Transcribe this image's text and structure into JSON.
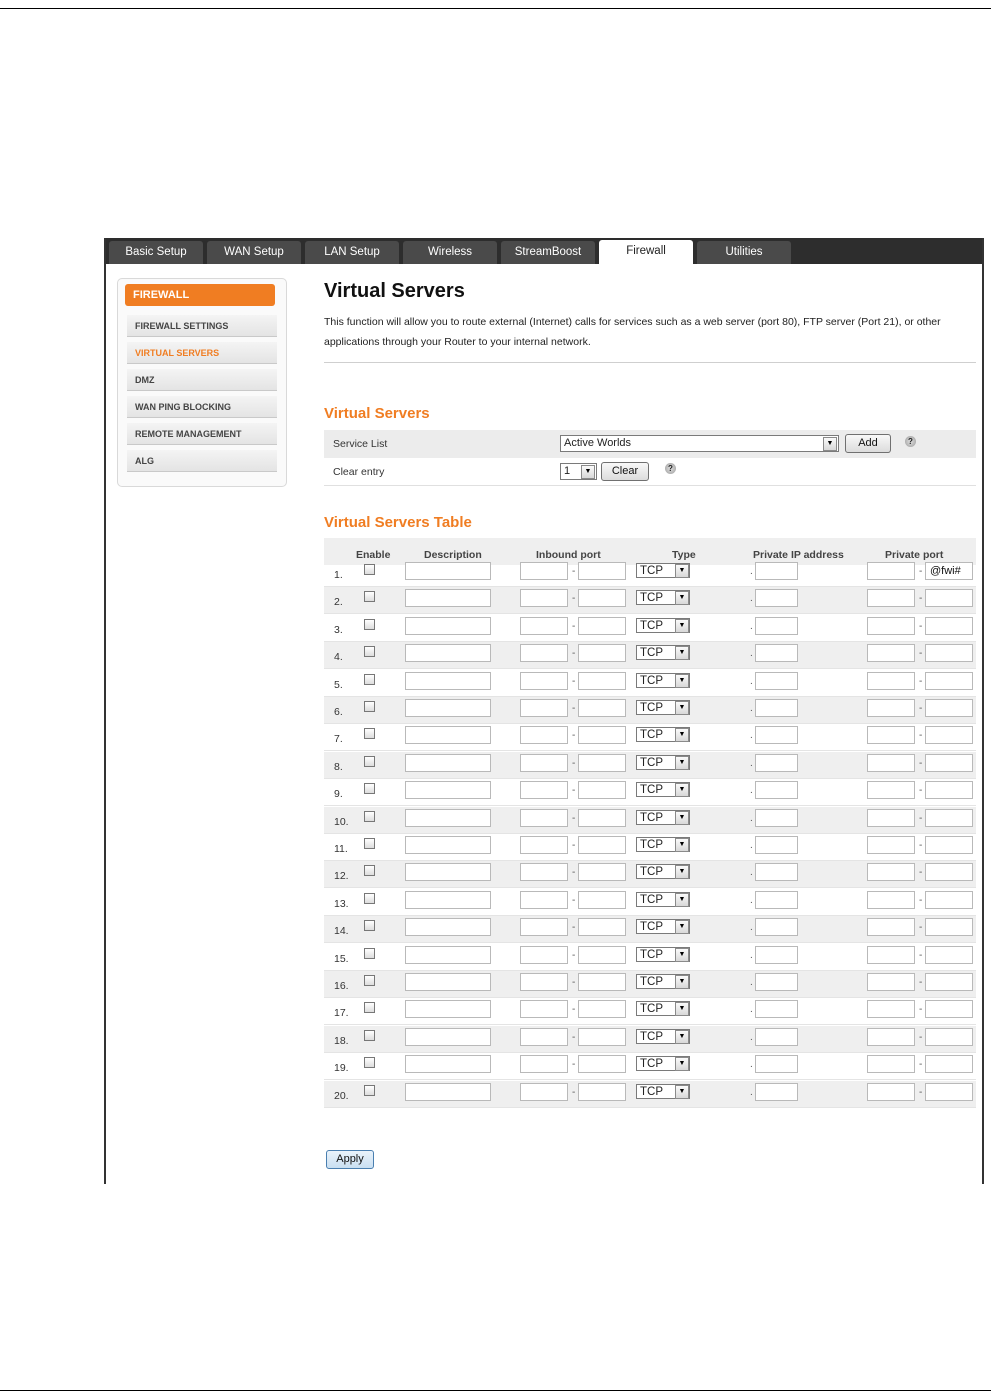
{
  "tabs": [
    "Basic Setup",
    "WAN Setup",
    "LAN Setup",
    "Wireless",
    "StreamBoost",
    "Firewall",
    "Utilities"
  ],
  "active_tab": "Firewall",
  "sidebar": {
    "header": "FIREWALL",
    "items": [
      "FIREWALL SETTINGS",
      "VIRTUAL SERVERS",
      "DMZ",
      "WAN PING BLOCKING",
      "REMOTE MANAGEMENT",
      "ALG"
    ],
    "active_item": "VIRTUAL SERVERS"
  },
  "main": {
    "title": "Virtual Servers",
    "description": "This function will allow you to route external (Internet) calls for services such as a web server (port 80), FTP server (Port 21), or other applications through your Router to your internal network."
  },
  "virtual_servers": {
    "section_title": "Virtual Servers",
    "service_list_label": "Service List",
    "service_list_value": "Active Worlds",
    "add_label": "Add",
    "clear_entry_label": "Clear entry",
    "clear_entry_value": "1",
    "clear_label": "Clear",
    "help_glyph": "?"
  },
  "table": {
    "title": "Virtual Servers Table",
    "headers": {
      "enable": "Enable",
      "description": "Description",
      "inbound_port": "Inbound port",
      "type": "Type",
      "private_ip": "Private IP address",
      "private_port": "Private port"
    },
    "rows": [
      {
        "num": "1.",
        "type": "TCP",
        "private_port_end": "@fwi#"
      },
      {
        "num": "2.",
        "type": "TCP",
        "private_port_end": ""
      },
      {
        "num": "3.",
        "type": "TCP",
        "private_port_end": ""
      },
      {
        "num": "4.",
        "type": "TCP",
        "private_port_end": ""
      },
      {
        "num": "5.",
        "type": "TCP",
        "private_port_end": ""
      },
      {
        "num": "6.",
        "type": "TCP",
        "private_port_end": ""
      },
      {
        "num": "7.",
        "type": "TCP",
        "private_port_end": ""
      },
      {
        "num": "8.",
        "type": "TCP",
        "private_port_end": ""
      },
      {
        "num": "9.",
        "type": "TCP",
        "private_port_end": ""
      },
      {
        "num": "10.",
        "type": "TCP",
        "private_port_end": ""
      },
      {
        "num": "11.",
        "type": "TCP",
        "private_port_end": ""
      },
      {
        "num": "12.",
        "type": "TCP",
        "private_port_end": ""
      },
      {
        "num": "13.",
        "type": "TCP",
        "private_port_end": ""
      },
      {
        "num": "14.",
        "type": "TCP",
        "private_port_end": ""
      },
      {
        "num": "15.",
        "type": "TCP",
        "private_port_end": ""
      },
      {
        "num": "16.",
        "type": "TCP",
        "private_port_end": ""
      },
      {
        "num": "17.",
        "type": "TCP",
        "private_port_end": ""
      },
      {
        "num": "18.",
        "type": "TCP",
        "private_port_end": ""
      },
      {
        "num": "19.",
        "type": "TCP",
        "private_port_end": ""
      },
      {
        "num": "20.",
        "type": "TCP",
        "private_port_end": ""
      }
    ],
    "range_separator": "-",
    "ip_prefix": "."
  },
  "apply_label": "Apply",
  "colors": {
    "accent": "#f07d22",
    "tabbar": "#2d2d2d",
    "tab": "#4a4a4a"
  }
}
